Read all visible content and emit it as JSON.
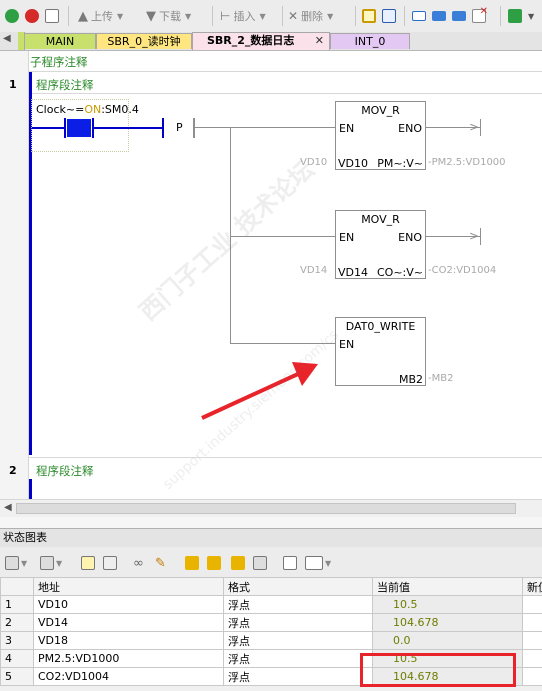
{
  "toolbar": {
    "upload_label": "上传",
    "download_label": "下载",
    "insert_label": "插入",
    "delete_label": "删除"
  },
  "tabs": [
    {
      "label": "MAIN"
    },
    {
      "label": "SBR_0_读时钟"
    },
    {
      "label": "SBR_2_数据日志"
    },
    {
      "label": "INT_0"
    }
  ],
  "editor": {
    "subroutine_comment": "子程序注释",
    "network1": {
      "number": "1",
      "comment": "程序段注释",
      "contact_label_prefix": "Clock~=",
      "contact_label_on": "ON",
      "contact_label_suffix": ":SM0.4",
      "p_label": "P",
      "mov1": {
        "title": "MOV_R",
        "en": "EN",
        "eno": "ENO",
        "in_ext": "VD10",
        "in_pin": "VD10",
        "out_pin": "PM~:V~",
        "out_ext": "PM2.5:VD1000"
      },
      "mov2": {
        "title": "MOV_R",
        "en": "EN",
        "eno": "ENO",
        "in_ext": "VD14",
        "in_pin": "VD14",
        "out_pin": "CO~:V~",
        "out_ext": "CO2:VD1004"
      },
      "dat": {
        "title": "DAT0_WRITE",
        "en": "EN",
        "out_pin": "MB2",
        "out_ext": "MB2"
      }
    },
    "network2": {
      "number": "2",
      "comment": "程序段注释"
    }
  },
  "watermark": {
    "cn": "西门子工业  技术论坛",
    "url": "support.industry.siemens.com/cs"
  },
  "status_chart": {
    "title": "状态图表",
    "columns": [
      "",
      "地址",
      "格式",
      "当前值",
      "新值"
    ],
    "rows": [
      {
        "index": "1",
        "address": "VD10",
        "format": "浮点",
        "value": "10.5"
      },
      {
        "index": "2",
        "address": "VD14",
        "format": "浮点",
        "value": "104.678"
      },
      {
        "index": "3",
        "address": "VD18",
        "format": "浮点",
        "value": "0.0"
      },
      {
        "index": "4",
        "address": "PM2.5:VD1000",
        "format": "浮点",
        "value": "10.5"
      },
      {
        "index": "5",
        "address": "CO2:VD1004",
        "format": "浮点",
        "value": "104.678"
      }
    ]
  },
  "colors": {
    "highlight_box": "#e8232a",
    "value_text": "#6f7d00",
    "comment_green": "#2b8a2b",
    "power_rail": "#0000c8"
  }
}
